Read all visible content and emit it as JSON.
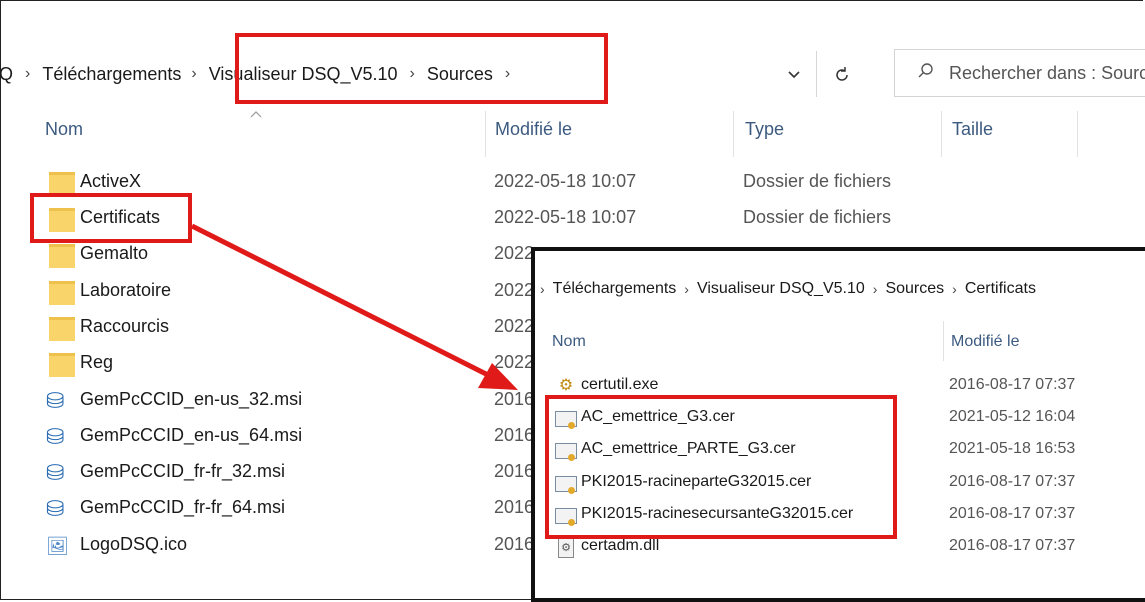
{
  "breadcrumb": [
    "Q",
    "Téléchargements",
    "Visualiseur DSQ_V5.10",
    "Sources"
  ],
  "nav": {
    "dropdown_icon": "chevron-down-icon",
    "refresh_icon": "refresh-icon"
  },
  "search": {
    "placeholder": "Rechercher dans : Sources",
    "icon": "search-icon"
  },
  "columns": {
    "name": "Nom",
    "modified": "Modifié le",
    "type": "Type",
    "size": "Taille"
  },
  "files": [
    {
      "name": "ActiveX",
      "modified": "2022-05-18 10:07",
      "type": "Dossier de fichiers",
      "icon": "folder-icon"
    },
    {
      "name": "Certificats",
      "modified": "2022-05-18 10:07",
      "type": "Dossier de fichiers",
      "icon": "folder-icon"
    },
    {
      "name": "Gemalto",
      "modified": "2022",
      "type": "",
      "icon": "folder-icon"
    },
    {
      "name": "Laboratoire",
      "modified": "2022",
      "type": "",
      "icon": "folder-icon"
    },
    {
      "name": "Raccourcis",
      "modified": "2022",
      "type": "",
      "icon": "folder-icon"
    },
    {
      "name": "Reg",
      "modified": "2022",
      "type": "",
      "icon": "folder-icon"
    },
    {
      "name": "GemPcCCID_en-us_32.msi",
      "modified": "2016",
      "type": "",
      "icon": "installer-icon"
    },
    {
      "name": "GemPcCCID_en-us_64.msi",
      "modified": "2016",
      "type": "",
      "icon": "installer-icon"
    },
    {
      "name": "GemPcCCID_fr-fr_32.msi",
      "modified": "2016",
      "type": "",
      "icon": "installer-icon"
    },
    {
      "name": "GemPcCCID_fr-fr_64.msi",
      "modified": "2016",
      "type": "",
      "icon": "installer-icon"
    },
    {
      "name": "LogoDSQ.ico",
      "modified": "2016",
      "type": "",
      "icon": "image-icon"
    }
  ],
  "popup": {
    "breadcrumb": [
      "Téléchargements",
      "Visualiseur DSQ_V5.10",
      "Sources",
      "Certificats"
    ],
    "columns": {
      "name": "Nom",
      "modified": "Modifié le"
    },
    "files": [
      {
        "name": "certutil.exe",
        "modified": "2016-08-17 07:37",
        "icon": "executable-icon"
      },
      {
        "name": "AC_emettrice_G3.cer",
        "modified": "2021-05-12 16:04",
        "icon": "certificate-icon"
      },
      {
        "name": "AC_emettrice_PARTE_G3.cer",
        "modified": "2021-05-18 16:53",
        "icon": "certificate-icon"
      },
      {
        "name": "PKI2015-racineparteG32015.cer",
        "modified": "2016-08-17 07:37",
        "icon": "certificate-icon"
      },
      {
        "name": "PKI2015-racinesecursanteG32015.cer",
        "modified": "2016-08-17 07:37",
        "icon": "certificate-icon"
      },
      {
        "name": "certadm.dll",
        "modified": "2016-08-17 07:37",
        "icon": "dll-icon"
      }
    ]
  },
  "colors": {
    "highlight": "#e01919",
    "folder": "#f8d46a",
    "header_text": "#3c5a80"
  }
}
